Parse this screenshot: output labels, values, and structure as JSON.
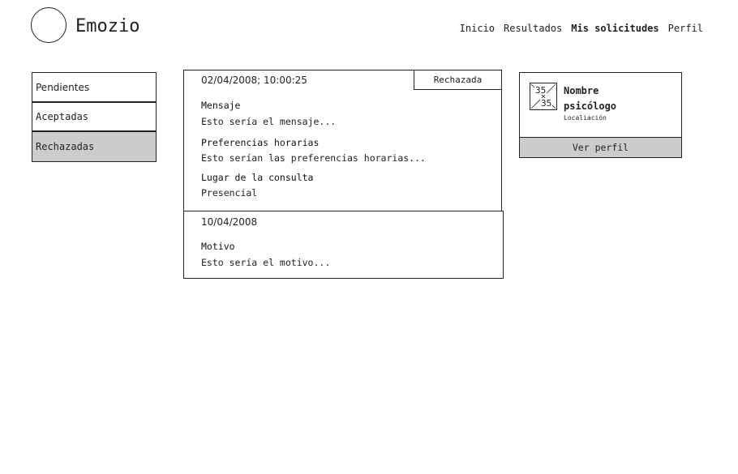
{
  "brand": {
    "name": "Emozio"
  },
  "nav": {
    "inicio": "Inicio",
    "resultados": "Resultados",
    "solicitudes": "Mis solicitudes",
    "perfil": "Perfil"
  },
  "tabs": {
    "pendientes": "Pendientes",
    "aceptadas": "Aceptadas",
    "rechazadas": "Rechazadas",
    "selected": "Rechazadas"
  },
  "request": {
    "date": "02/04/2008; 10:00:25",
    "status": "Rechazada",
    "message_label": "Mensaje",
    "message_value": "Esto sería el mensaje...",
    "prefs_label": "Preferencias horarias",
    "prefs_value": "Esto serían las preferencias horarias...",
    "location_label": "Lugar de la consulta",
    "location_value": "Presencial"
  },
  "response": {
    "date": "10/04/2008",
    "reason_label": "Motivo",
    "reason_value": "Esto sería el motivo..."
  },
  "psychologist": {
    "name_line1": "Nombre",
    "name_line2": "psicólogo",
    "location": "Localiación",
    "view_button": "Ver perfil",
    "thumb_text_top": "35",
    "thumb_text_bottom": "35"
  },
  "colors": {
    "selected_tab_bg": "#cccccc",
    "button_bg": "#cccccc",
    "border": "#222222"
  }
}
